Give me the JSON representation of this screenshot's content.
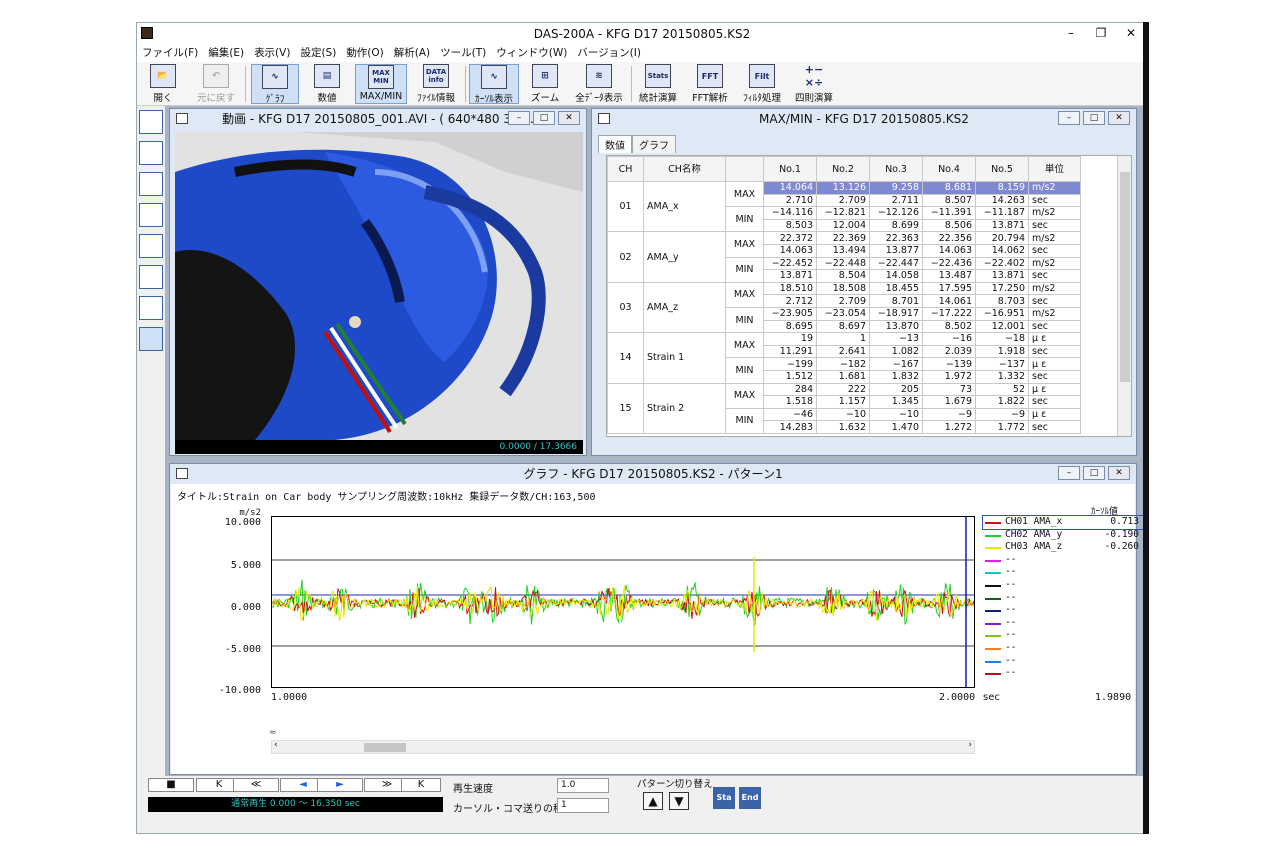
{
  "app": {
    "title": "DAS-200A - KFG D17 20150805.KS2",
    "min": "–",
    "restore": "❐",
    "close": "✕"
  },
  "menu": [
    "ファイル(F)",
    "編集(E)",
    "表示(V)",
    "設定(S)",
    "動作(O)",
    "解析(A)",
    "ツール(T)",
    "ウィンドウ(W)",
    "バージョン(I)"
  ],
  "toolbar": {
    "open": "開く",
    "undo": "元に戻す",
    "graph": "ｸﾞﾗﾌ",
    "numeric": "数値",
    "maxmin": "MAX/MIN",
    "fileinfo": "ﾌｧｲﾙ情報",
    "cursor": "ｶｰｿﾙ表示",
    "zoom": "ズーム",
    "alldata": "全ﾃﾞｰﾀ表示",
    "stats": "統計演算",
    "fft": "FFT解析",
    "filter": "ﾌｨﾙﾀ処理",
    "arith": "四則演算",
    "maxmin_icon": "MAX MIN",
    "data_icon": "DATA info",
    "stats_icon": "Stats",
    "fft_icon": "FFT",
    "filt_icon": "Filt",
    "arith_icon": "+− ×÷"
  },
  "video": {
    "title": "動画 - KFG D17 20150805_001.AVI - ( 640*480 30....",
    "time": "0.0000 / 17.3666"
  },
  "maxmin": {
    "title": "MAX/MIN - KFG D17 20150805.KS2",
    "tabs": [
      "数値",
      "グラフ"
    ],
    "headers": [
      "CH",
      "CH名称",
      "",
      "No.1",
      "No.2",
      "No.3",
      "No.4",
      "No.5",
      "単位"
    ],
    "groups": [
      {
        "ch": "01",
        "name": "AMA_x",
        "rows": [
          [
            "14.064",
            "13.126",
            "9.258",
            "8.681",
            "8.159",
            "m/s2"
          ],
          [
            "2.710",
            "2.709",
            "2.711",
            "8.507",
            "14.263",
            "sec"
          ],
          [
            "−14.116",
            "−12.821",
            "−12.126",
            "−11.391",
            "−11.187",
            "m/s2"
          ],
          [
            "8.503",
            "12.004",
            "8.699",
            "8.506",
            "13.871",
            "sec"
          ]
        ]
      },
      {
        "ch": "02",
        "name": "AMA_y",
        "rows": [
          [
            "22.372",
            "22.369",
            "22.363",
            "22.356",
            "20.794",
            "m/s2"
          ],
          [
            "14.063",
            "13.494",
            "13.877",
            "14.063",
            "14.062",
            "sec"
          ],
          [
            "−22.452",
            "−22.448",
            "−22.447",
            "−22.436",
            "−22.402",
            "m/s2"
          ],
          [
            "13.871",
            "8.504",
            "14.058",
            "13.487",
            "13.871",
            "sec"
          ]
        ]
      },
      {
        "ch": "03",
        "name": "AMA_z",
        "rows": [
          [
            "18.510",
            "18.508",
            "18.455",
            "17.595",
            "17.250",
            "m/s2"
          ],
          [
            "2.712",
            "2.709",
            "8.701",
            "14.061",
            "8.703",
            "sec"
          ],
          [
            "−23.905",
            "−23.054",
            "−18.917",
            "−17.222",
            "−16.951",
            "m/s2"
          ],
          [
            "8.695",
            "8.697",
            "13.870",
            "8.502",
            "12.001",
            "sec"
          ]
        ]
      },
      {
        "ch": "14",
        "name": "Strain 1",
        "rows": [
          [
            "19",
            "1",
            "−13",
            "−16",
            "−18",
            "μ ε"
          ],
          [
            "11.291",
            "2.641",
            "1.082",
            "2.039",
            "1.918",
            "sec"
          ],
          [
            "−199",
            "−182",
            "−167",
            "−139",
            "−137",
            "μ ε"
          ],
          [
            "1.512",
            "1.681",
            "1.832",
            "1.972",
            "1.332",
            "sec"
          ]
        ]
      },
      {
        "ch": "15",
        "name": "Strain 2",
        "rows": [
          [
            "284",
            "222",
            "205",
            "73",
            "52",
            "μ ε"
          ],
          [
            "1.518",
            "1.157",
            "1.345",
            "1.679",
            "1.822",
            "sec"
          ],
          [
            "−46",
            "−10",
            "−10",
            "−9",
            "−9",
            "μ ε"
          ],
          [
            "14.283",
            "1.632",
            "1.470",
            "1.272",
            "1.772",
            "sec"
          ]
        ]
      }
    ],
    "max_label": "MAX",
    "min_label": "MIN"
  },
  "graph": {
    "title": "グラフ - KFG D17 20150805.KS2 - パターン1",
    "info": "タイトル:Strain on Car body  サンプリング周波数:10kHz  集録データ数/CH:163,500",
    "unit": "m/s2",
    "cursor_header": "ｶｰｿﾙ値",
    "yticks": [
      "10.000",
      "5.000",
      "0.000",
      "-5.000",
      "-10.000"
    ],
    "x_start": "1.0000",
    "x_end": "2.0000",
    "x_unit": "sec",
    "cursor_pos": "1.9890",
    "legend": [
      {
        "name": "CH01 AMA_x",
        "value": "0.713",
        "color": "#d01010"
      },
      {
        "name": "CH02 AMA_y",
        "value": "-0.190",
        "color": "#20d020"
      },
      {
        "name": "CH03 AMA_z",
        "value": "-0.260",
        "color": "#e8e800"
      },
      {
        "name": "--",
        "value": "",
        "color": "#e020e0"
      },
      {
        "name": "--",
        "value": "",
        "color": "#10c8c8"
      },
      {
        "name": "--",
        "value": "",
        "color": "#101010"
      },
      {
        "name": "--",
        "value": "",
        "color": "#106010"
      },
      {
        "name": "--",
        "value": "",
        "color": "#102080"
      },
      {
        "name": "--",
        "value": "",
        "color": "#8020d0"
      },
      {
        "name": "--",
        "value": "",
        "color": "#80c020"
      },
      {
        "name": "--",
        "value": "",
        "color": "#f08020"
      },
      {
        "name": "--",
        "value": "",
        "color": "#2080e0"
      },
      {
        "name": "--",
        "value": "",
        "color": "#c01010"
      }
    ]
  },
  "playback": {
    "stop": "■",
    "first": "K",
    "rewind": "≪",
    "back": "◄",
    "play": "►",
    "ff": "≫",
    "last": "K",
    "status": "通常再生  0.000 〜 16.350 sec",
    "speed_label": "再生速度",
    "speed_value": "1.0",
    "step_label": "カーソル・コマ送りの移動量",
    "step_value": "1",
    "pattern_label": "パターン切り替え",
    "up": "▲",
    "down": "▼",
    "sta": "Sta",
    "end": "End"
  }
}
